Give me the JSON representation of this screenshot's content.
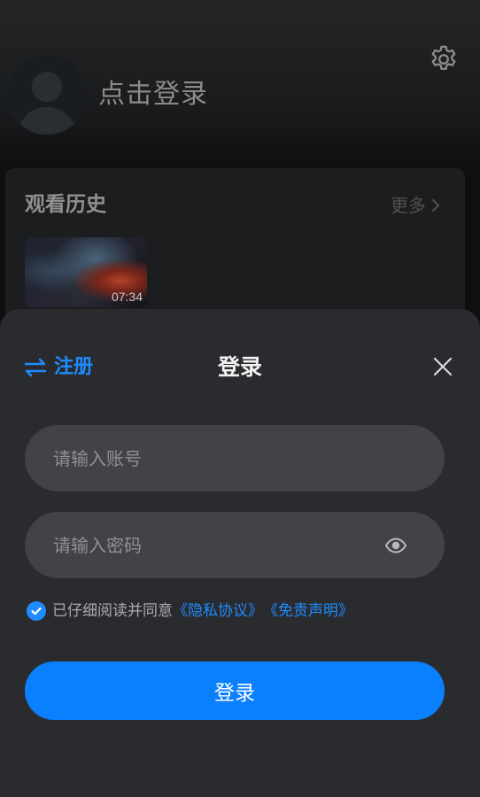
{
  "profile": {
    "login_prompt": "点击登录",
    "settings_icon": "gear-icon",
    "avatar_icon": "default-avatar-icon"
  },
  "history": {
    "title": "观看历史",
    "more_label": "更多",
    "items": [
      {
        "duration": "07:34"
      }
    ]
  },
  "login_sheet": {
    "register_label": "注册",
    "register_icon": "swap-arrows-icon",
    "title": "登录",
    "close_icon": "close-icon",
    "account_input": {
      "placeholder": "请输入账号",
      "value": ""
    },
    "password_input": {
      "placeholder": "请输入密码",
      "value": "",
      "toggle_icon": "eye-icon"
    },
    "agreement": {
      "checked": true,
      "text": "已仔细阅读并同意",
      "privacy_link": "《隐私协议》",
      "disclaimer_link": "《免责声明》"
    },
    "submit_label": "登录"
  },
  "colors": {
    "accent": "#0a80ff",
    "sheet_background": "#2a2b2f",
    "input_background": "#424347"
  }
}
